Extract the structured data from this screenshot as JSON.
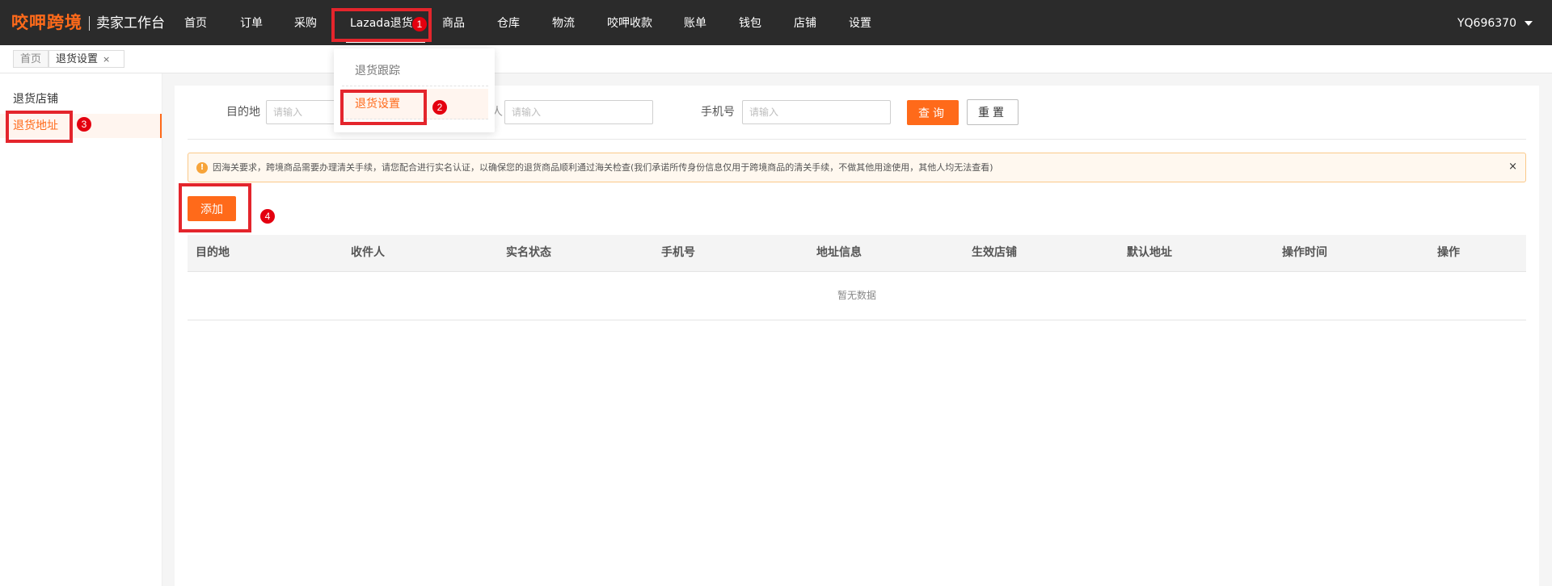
{
  "header": {
    "brand": "咬呷跨境",
    "subtitle": "卖家工作台",
    "nav": [
      "首页",
      "订单",
      "采购",
      "Lazada退货",
      "商品",
      "仓库",
      "物流",
      "咬呷收款",
      "账单",
      "钱包",
      "店铺",
      "设置"
    ],
    "active_nav": "Lazada退货",
    "user": "YQ696370"
  },
  "tabs": {
    "home": "首页",
    "active": "退货设置",
    "close": "×"
  },
  "dropdown": {
    "items": [
      "退货跟踪",
      "退货设置"
    ],
    "selected": "退货设置"
  },
  "sidebar": {
    "items": [
      "退货店铺",
      "退货地址"
    ],
    "selected": "退货地址"
  },
  "filters": {
    "destination_label": "目的地",
    "destination_placeholder": "请输入",
    "second_placeholder": "请输入",
    "second_label_fragment": "人",
    "phone_label": "手机号",
    "phone_placeholder": "请输入",
    "query_button": "查询",
    "reset_button": "重置"
  },
  "notice": {
    "icon": "!",
    "text": "因海关要求，跨境商品需要办理清关手续，请您配合进行实名认证，以确保您的退货商品顺利通过海关检查(我们承诺所传身份信息仅用于跨境商品的清关手续，不做其他用途使用，其他人均无法查看)",
    "close": "×"
  },
  "actions": {
    "add_button": "添加"
  },
  "table": {
    "columns": [
      "目的地",
      "收件人",
      "实名状态",
      "手机号",
      "地址信息",
      "生效店铺",
      "默认地址",
      "操作时间",
      "操作"
    ],
    "empty_text": "暂无数据"
  },
  "annotations": {
    "steps": [
      "1",
      "2",
      "3",
      "4"
    ],
    "color": "#e4252c"
  },
  "colors": {
    "header_bg": "#2b2b2b",
    "accent": "#ff6a1a",
    "notice_bg": "#fff8ef",
    "notice_border": "#fbc98a"
  }
}
